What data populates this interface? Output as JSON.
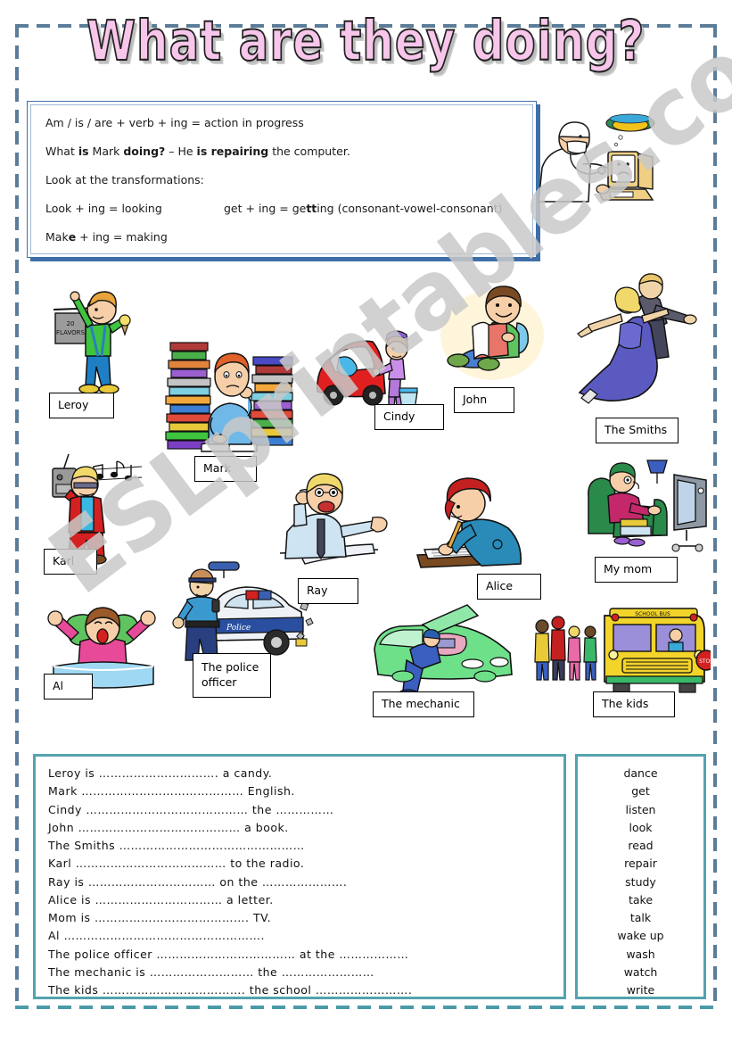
{
  "title": "What are they doing?",
  "grammar": {
    "rule": "Am / is / are + verb + ing = action in progress",
    "example_pre": "What ",
    "example_is": "is",
    "example_name": " Mark ",
    "example_doing": "doing?",
    "example_mid": " – He ",
    "example_isrep": "is repairing",
    "example_end": " the computer.",
    "transform_heading": "Look at the transformations:",
    "t1": "Look + ing = looking",
    "t2_pre": "get + ing = ge",
    "t2_bold": "tt",
    "t2_post": "ing (consonant-vowel-consonant)",
    "t3_pre": "Mak",
    "t3_bold": "e",
    "t3_post": " + ing = making",
    "clipart_name": "computer-doctor-clipart"
  },
  "pictures": [
    {
      "label": "Leroy",
      "clip": "boy-taking-candy"
    },
    {
      "label": "Mark",
      "clip": "boy-studying-books"
    },
    {
      "label": "Cindy",
      "clip": "woman-washing-car"
    },
    {
      "label": "John",
      "clip": "boy-reading-book"
    },
    {
      "label": "The Smiths",
      "clip": "couple-dancing"
    },
    {
      "label": "Karl",
      "clip": "man-listening-radio"
    },
    {
      "label": "Ray",
      "clip": "man-talking-phone"
    },
    {
      "label": "Alice",
      "clip": "woman-writing-letter"
    },
    {
      "label": "My mom",
      "clip": "woman-watching-tv"
    },
    {
      "label": "Al",
      "clip": "boy-waking-up"
    },
    {
      "label": "The police\nofficer",
      "clip": "police-officer-car"
    },
    {
      "label": "The mechanic",
      "clip": "mechanic-repairing-car"
    },
    {
      "label": "The kids",
      "clip": "kids-school-bus"
    }
  ],
  "exercise": {
    "lines": [
      "Leroy is …………………………. a candy.",
      "Mark …………………………………… English.",
      "Cindy …………………………………… the ……………",
      "John …………………………………… a book.",
      "The Smiths …………………………………………",
      "Karl ………………………………… to the radio.",
      "Ray is …………………………… on the ………………….",
      "Alice is …………………………… a letter.",
      "Mom is …………………………………. TV.",
      "Al …………………………………………….",
      "The police officer ……………………………… at the ………………",
      "The mechanic is ……………………… the ……………………",
      "The kids ………………………………. the school ……………………."
    ]
  },
  "wordbank": {
    "words": [
      "dance",
      "get",
      "listen",
      "look",
      "read",
      "repair",
      "study",
      "take",
      "talk",
      "wake up",
      "wash",
      "watch",
      "write"
    ]
  },
  "watermark": {
    "text": "ESLprintables.com"
  },
  "colors": {
    "title_fill": "#f7c6ea",
    "frame_top": "#5b7d99",
    "frame_bottom": "#4b9aa8",
    "grammar_border": "#3f6fa8",
    "box_border": "#55a2b0"
  }
}
